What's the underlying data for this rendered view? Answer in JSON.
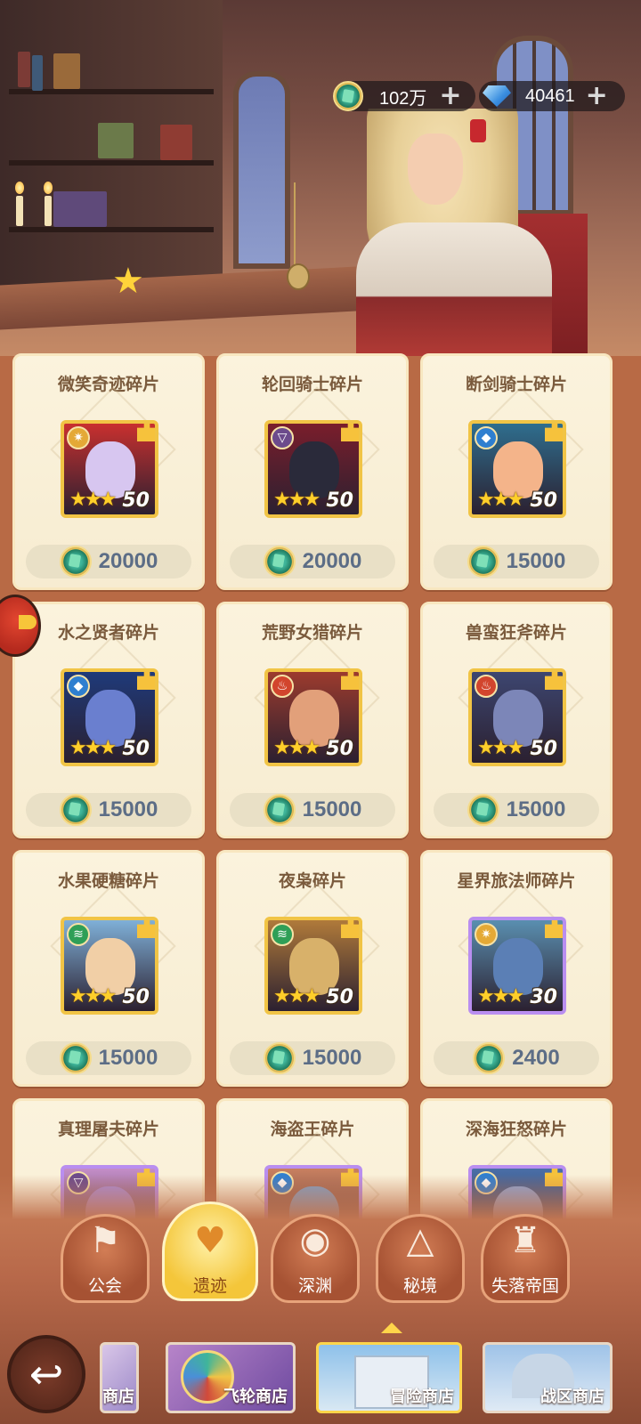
{
  "currency": {
    "gold": {
      "value": "102万",
      "icon": "gold-coin-icon",
      "add_icon": "plus-icon"
    },
    "diamond": {
      "value": "40461",
      "icon": "diamond-icon",
      "add_icon": "plus-icon"
    }
  },
  "items": [
    {
      "title": "微笑奇迹碎片",
      "count": "50",
      "stars": 3,
      "element": "light",
      "price": "20000"
    },
    {
      "title": "轮回骑士碎片",
      "count": "50",
      "stars": 3,
      "element": "dark",
      "price": "20000"
    },
    {
      "title": "断剑骑士碎片",
      "count": "50",
      "stars": 3,
      "element": "water",
      "price": "15000"
    },
    {
      "title": "水之贤者碎片",
      "count": "50",
      "stars": 3,
      "element": "water",
      "price": "15000"
    },
    {
      "title": "荒野女猎碎片",
      "count": "50",
      "stars": 3,
      "element": "fire",
      "price": "15000"
    },
    {
      "title": "兽蛮狂斧碎片",
      "count": "50",
      "stars": 3,
      "element": "fire",
      "price": "15000"
    },
    {
      "title": "水果硬糖碎片",
      "count": "50",
      "stars": 3,
      "element": "wind",
      "price": "15000"
    },
    {
      "title": "夜枭碎片",
      "count": "50",
      "stars": 3,
      "element": "wind",
      "price": "15000"
    },
    {
      "title": "星界旅法师碎片",
      "count": "30",
      "stars": 3,
      "element": "light",
      "price": "2400"
    },
    {
      "title": "真理屠夫碎片",
      "count": "",
      "stars": 0,
      "element": "dark",
      "price": ""
    },
    {
      "title": "海盗王碎片",
      "count": "",
      "stars": 0,
      "element": "water",
      "price": ""
    },
    {
      "title": "深海狂怒碎片",
      "count": "",
      "stars": 0,
      "element": "water",
      "price": ""
    }
  ],
  "tabs": [
    {
      "label": "公会",
      "icon": "guild-banner-icon"
    },
    {
      "label": "遗迹",
      "icon": "relic-crest-icon",
      "active": true
    },
    {
      "label": "深渊",
      "icon": "abyss-eye-icon"
    },
    {
      "label": "秘境",
      "icon": "secret-realm-icon"
    },
    {
      "label": "失落帝国",
      "icon": "lost-empire-icon"
    }
  ],
  "shops": [
    {
      "label": "商店"
    },
    {
      "label": "飞轮商店"
    },
    {
      "label": "冒险商店",
      "active": true
    },
    {
      "label": "战区商店"
    }
  ],
  "colors": {
    "background": "#b86a45",
    "card": "#fbf3dd",
    "card_title": "#7a5a3c",
    "price_text": "#5c6d86",
    "gold_frame": "#f1c445",
    "purple_frame": "#b98ef0",
    "active_tab": "#f4c63a"
  }
}
